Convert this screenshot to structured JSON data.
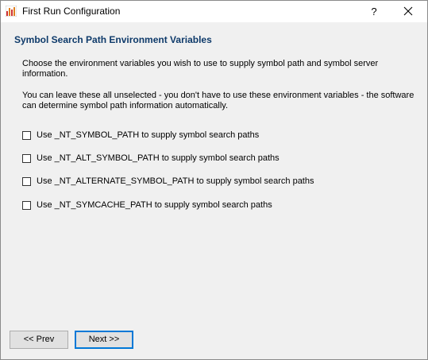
{
  "window": {
    "title": "First Run Configuration",
    "help_label": "?"
  },
  "page": {
    "heading": "Symbol Search Path Environment Variables",
    "intro": "Choose the environment variables you wish to use to supply symbol path and symbol server information.",
    "note": "You can leave these all unselected - you don't have to use these environment variables - the software can determine symbol path information automatically."
  },
  "options": [
    {
      "label": "Use _NT_SYMBOL_PATH to supply symbol search paths",
      "checked": false
    },
    {
      "label": "Use _NT_ALT_SYMBOL_PATH to supply symbol search paths",
      "checked": false
    },
    {
      "label": "Use _NT_ALTERNATE_SYMBOL_PATH to supply symbol search paths",
      "checked": false
    },
    {
      "label": "Use _NT_SYMCACHE_PATH to supply symbol search paths",
      "checked": false
    }
  ],
  "buttons": {
    "prev_label": "<< Prev",
    "next_label": "Next >>"
  },
  "colors": {
    "heading": "#0e3a6a",
    "focus_border": "#0078d7"
  }
}
